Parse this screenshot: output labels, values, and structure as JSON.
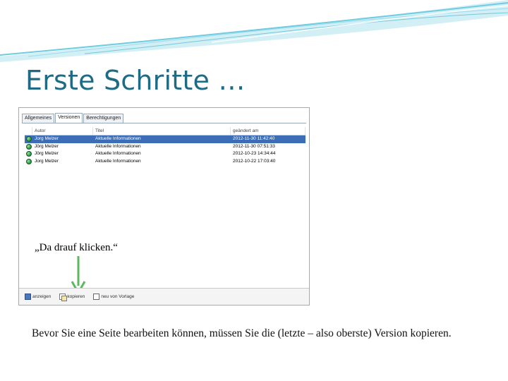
{
  "slide": {
    "title": "Erste Schritte …",
    "body": "Bevor Sie eine Seite bearbeiten können, müssen Sie die (letzte – also oberste) Version kopieren."
  },
  "screenshot": {
    "tabs": [
      {
        "label": "Allgemeines",
        "active": false
      },
      {
        "label": "Versionen",
        "active": true
      },
      {
        "label": "Berechtigungen",
        "active": false
      }
    ],
    "columns": {
      "author": "Autor",
      "title": "Titel",
      "date": "geändert am"
    },
    "rows": [
      {
        "author": "Jorg Melzer",
        "title": "Aktuelle Informationen",
        "date": "2012-11-30 11:42:40",
        "selected": true
      },
      {
        "author": "Jörg Melzer",
        "title": "Aktuelle Informationen",
        "date": "2012-11-30 07:51:33",
        "selected": false
      },
      {
        "author": "Jörg Melzer",
        "title": "Aktuelle Informationen",
        "date": "2012-10-23 14:34:44",
        "selected": false
      },
      {
        "author": "Jorg Melzer",
        "title": "Aktuelle Informationen",
        "date": "2012-10-22 17:03:40",
        "selected": false
      }
    ],
    "annotation": "„Da drauf klicken.“",
    "toolbar": {
      "view_label": "anzeigen",
      "copy_label": "kopieren",
      "new_label": "neu von Vorlage"
    }
  },
  "colors": {
    "title": "#1f6a84",
    "selection": "#3c6eb8",
    "arrow": "#5cb85c",
    "swoosh": "#67c6dc"
  }
}
